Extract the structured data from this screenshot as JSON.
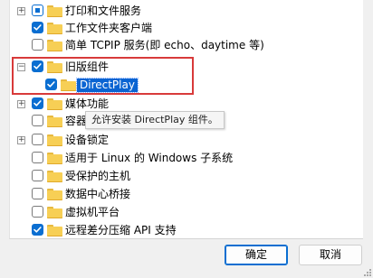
{
  "tree": {
    "items": [
      {
        "label": "打印和文件服务",
        "state": "part",
        "expander": "+"
      },
      {
        "label": "工作文件夹客户端",
        "state": "on",
        "expander": ""
      },
      {
        "label": "简单 TCPIP 服务(即 echo、daytime 等)",
        "state": "off",
        "expander": ""
      },
      {
        "label": "旧版组件",
        "state": "on",
        "expander": "−"
      },
      {
        "label": "DirectPlay",
        "state": "on",
        "expander": ""
      },
      {
        "label": "媒体功能",
        "state": "on",
        "expander": "+"
      },
      {
        "label": "容器",
        "state": "off",
        "expander": ""
      },
      {
        "label": "设备锁定",
        "state": "off",
        "expander": "+"
      },
      {
        "label": "适用于 Linux 的 Windows 子系统",
        "state": "off",
        "expander": ""
      },
      {
        "label": "受保护的主机",
        "state": "off",
        "expander": ""
      },
      {
        "label": "数据中心桥接",
        "state": "off",
        "expander": ""
      },
      {
        "label": "虚拟机平台",
        "state": "off",
        "expander": ""
      },
      {
        "label": "远程差分压缩 API 支持",
        "state": "on",
        "expander": ""
      }
    ]
  },
  "tooltip": {
    "text": "允许安装 DirectPlay 组件。"
  },
  "buttons": {
    "ok": "确定",
    "cancel": "取消"
  }
}
